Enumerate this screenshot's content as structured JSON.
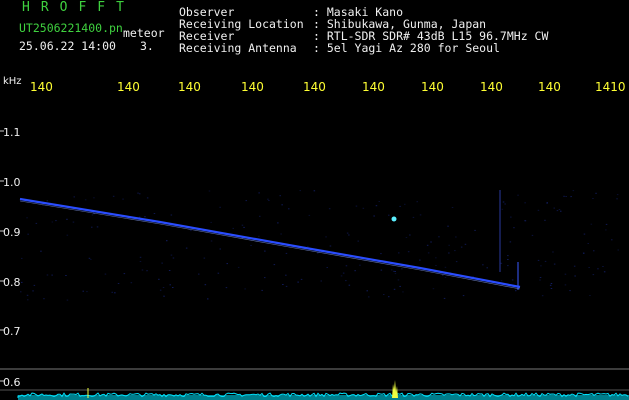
{
  "header": {
    "app_title": "HROFFT",
    "filename": "UT2506221400.pn",
    "meteor_label": "meteor",
    "datetime": "25.06.22 14:00",
    "count": "3.",
    "observer_label": "Observer",
    "observer_value": ": Masaki Kano",
    "location_label": "Receiving Location",
    "location_value": ": Shibukawa, Gunma, Japan",
    "receiver_label": "Receiver",
    "receiver_value": ": RTL-SDR SDR# 43dB L15 96.7MHz CW",
    "antenna_label": "Receiving Antenna",
    "antenna_value": ": 5el Yagi Az 280 for Seoul"
  },
  "axes": {
    "y_unit": "kHz",
    "y_ticks": [
      "1.1",
      "1.0",
      "0.9",
      "0.8",
      "0.7",
      "0.6"
    ],
    "x_ticks": [
      "140",
      "140",
      "140",
      "140",
      "140",
      "140",
      "140",
      "140",
      "140",
      "1410"
    ]
  },
  "colors": {
    "background": "#000000",
    "trace": "#2a4dff",
    "noise": "#1a2a8a",
    "baseline": "#00e5ff",
    "tick_label": "#ffff33",
    "header_green": "#3fd13f"
  }
}
